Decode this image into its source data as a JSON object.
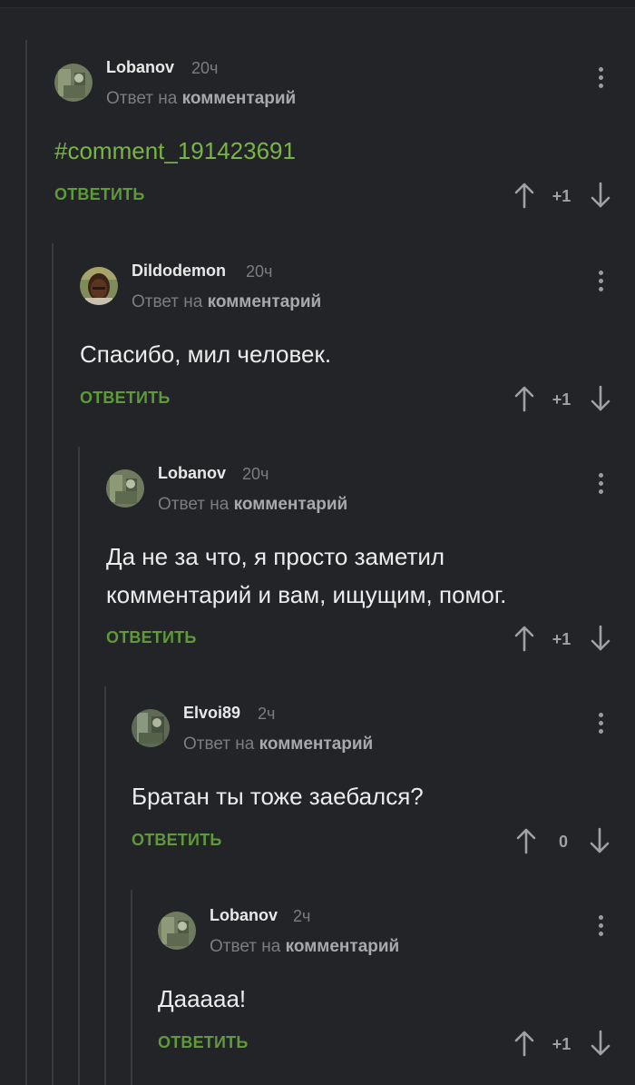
{
  "comments": [
    {
      "author": "Lobanov",
      "time": "20ч",
      "reply_prefix": "Ответ на",
      "reply_target": "комментарий",
      "text": [
        "#comment_191423691"
      ],
      "text_is_link": true,
      "reply_label": "ОТВЕТИТЬ",
      "score": "+1"
    },
    {
      "author": "Dildodemon",
      "time": "20ч",
      "reply_prefix": "Ответ на",
      "reply_target": "комментарий",
      "text": [
        "Спасибо, мил человек."
      ],
      "text_is_link": false,
      "reply_label": "ОТВЕТИТЬ",
      "score": "+1"
    },
    {
      "author": "Lobanov",
      "time": "20ч",
      "reply_prefix": "Ответ на",
      "reply_target": "комментарий",
      "text": [
        "Да не за что, я просто заметил",
        "комментарий и вам, ищущим, помог."
      ],
      "text_is_link": false,
      "reply_label": "ОТВЕТИТЬ",
      "score": "+1"
    },
    {
      "author": "Elvoi89",
      "time": "2ч",
      "reply_prefix": "Ответ на",
      "reply_target": "комментарий",
      "text": [
        "Братан ты тоже заебался?"
      ],
      "text_is_link": false,
      "reply_label": "ОТВЕТИТЬ",
      "score": "0"
    },
    {
      "author": "Lobanov",
      "time": "2ч",
      "reply_prefix": "Ответ на",
      "reply_target": "комментарий",
      "text": [
        "Даааaa!"
      ],
      "text_is_link": false,
      "reply_label": "ОТВЕТИТЬ",
      "score": "+1"
    }
  ],
  "icons": {
    "menu": "more-vertical-icon",
    "upvote": "arrow-up-icon",
    "downvote": "arrow-down-icon"
  },
  "colors": {
    "background": "#232427",
    "accent_green": "#5f9a3a",
    "link_green": "#79b545",
    "muted": "#7c7d80",
    "thread_line": "#3a3b3f"
  }
}
